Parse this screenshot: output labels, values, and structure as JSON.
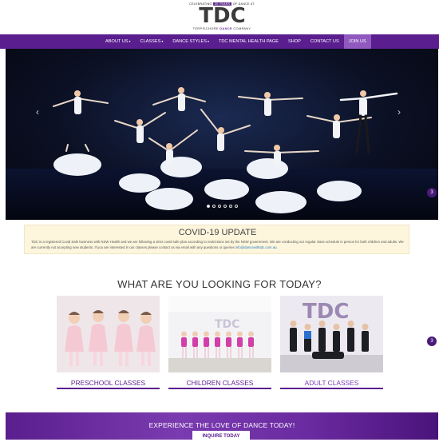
{
  "logo": {
    "tagline_left": "CELEBRATING",
    "tagline_years": "20 YEARS",
    "tagline_right": "OF DANCE AT",
    "letters": [
      "T",
      "D",
      "C"
    ],
    "line_left": "TERPSICHORE ",
    "line_mid": "DANCE",
    "line_right": " COMPANY"
  },
  "nav": {
    "items": [
      {
        "label": "ABOUT US",
        "caret": "▾"
      },
      {
        "label": "CLASSES",
        "caret": "▾"
      },
      {
        "label": "DANCE STYLES",
        "caret": "▾"
      },
      {
        "label": "TDC MENTAL HEALTH PAGE",
        "caret": ""
      },
      {
        "label": "SHOP",
        "caret": ""
      },
      {
        "label": "CONTACT US",
        "caret": ""
      },
      {
        "label": "JOIN US",
        "caret": ""
      }
    ],
    "active_index": 6
  },
  "hero": {
    "prev_icon": "‹",
    "next_icon": "›",
    "slide_count": 6,
    "active_slide": 0
  },
  "side_badges": [
    "3",
    "3"
  ],
  "covid": {
    "title": "COVID-19 UPDATE",
    "text": "TDC is a registered Covid Safe business with NSW Health and we are following a strict covid safe plan according to restrictions set by the NSW government. We are conducting our regular class schedule in person for both children and adults. We are currently not accepting new students. If you are interested in our classes please contact us via email with any questions or queries ",
    "email": "info@dancewithtdc.com.au",
    "end": "."
  },
  "section": {
    "title": "WHAT ARE YOU LOOKING FOR TODAY?"
  },
  "cards": [
    {
      "label": "PRESCHOOL CLASSES"
    },
    {
      "label": "CHILDREN CLASSES"
    },
    {
      "label": "ADULT CLASSES"
    }
  ],
  "cta": {
    "text": "EXPERIENCE THE LOVE OF DANCE TODAY!",
    "button": "INQUIRE TODAY"
  },
  "colors": {
    "brand_purple": "#5a1e8e",
    "nav_active": "#8f59bf",
    "covid_bg": "#fdf6dd",
    "link_blue": "#2a7bbf"
  }
}
